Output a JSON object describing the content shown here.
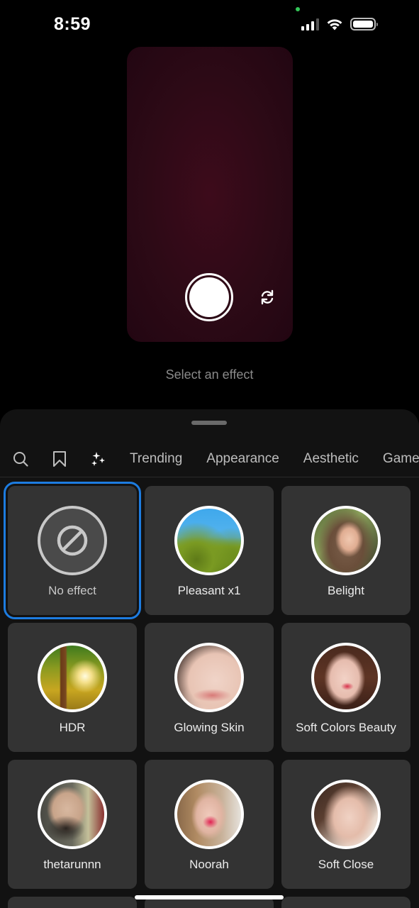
{
  "status_bar": {
    "time": "8:59",
    "privacy_dot_color": "#34c759",
    "signal_bars": 3,
    "signal_total": 4
  },
  "camera": {
    "hint": "Select an effect",
    "shutter_icon": "shutter-button",
    "flip_icon": "flip-camera-icon"
  },
  "sheet": {
    "icon_tabs": [
      {
        "name": "search",
        "icon": "search-icon"
      },
      {
        "name": "saved",
        "icon": "bookmark-icon"
      },
      {
        "name": "for-you",
        "icon": "sparkles-icon",
        "active": true
      }
    ],
    "tabs": [
      {
        "label": "Trending"
      },
      {
        "label": "Appearance"
      },
      {
        "label": "Aesthetic"
      },
      {
        "label": "Games"
      }
    ],
    "effects": [
      {
        "label": "No effect",
        "selected": true,
        "icon": "no-effect-icon"
      },
      {
        "label": "Pleasant x1",
        "thumb": "sky-trees"
      },
      {
        "label": "Belight",
        "thumb": "portrait-woman-smiling"
      },
      {
        "label": "HDR",
        "thumb": "forest-sunlight"
      },
      {
        "label": "Glowing Skin",
        "thumb": "portrait-girl-braces"
      },
      {
        "label": "Soft Colors Beauty",
        "thumb": "portrait-curly-hair"
      },
      {
        "label": "thetarunnn",
        "thumb": "portrait-man-beard"
      },
      {
        "label": "Noorah",
        "thumb": "portrait-woman-lips"
      },
      {
        "label": "Soft Close",
        "thumb": "portrait-woman-close"
      }
    ]
  },
  "colors": {
    "selected_outline": "#1d7ce0",
    "card_bg": "#333333",
    "sheet_bg": "#121212",
    "preview_tint": "#3d0b1b"
  }
}
